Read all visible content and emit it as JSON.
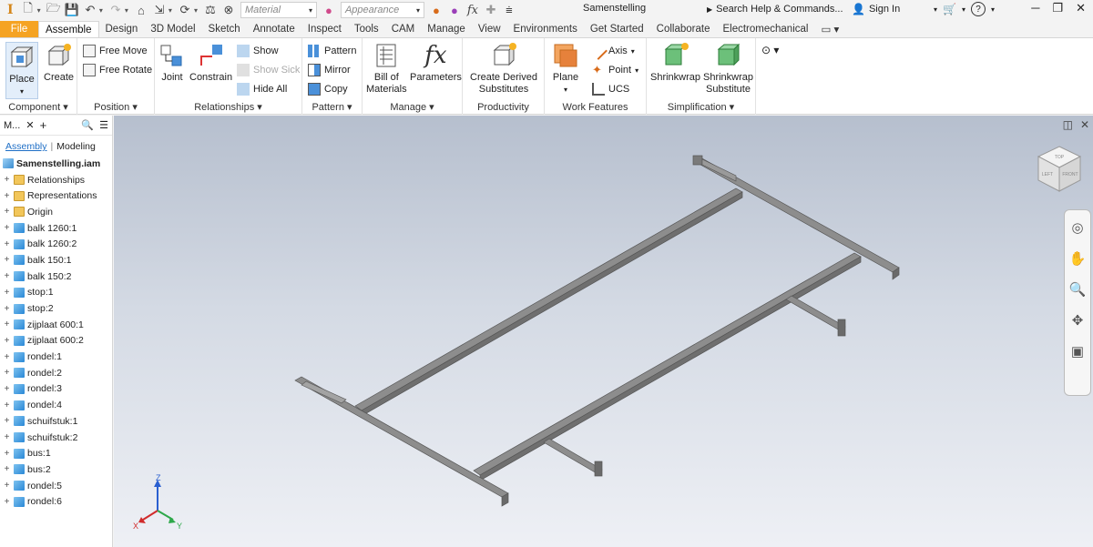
{
  "qat": {
    "app_logo": "I",
    "material_placeholder": "Material",
    "appearance_placeholder": "Appearance",
    "doc_title": "Samenstelling",
    "help_search": "Search Help & Commands...",
    "sign_in": "Sign In",
    "help_icon": "?"
  },
  "tabs": [
    "File",
    "Assemble",
    "Design",
    "3D Model",
    "Sketch",
    "Annotate",
    "Inspect",
    "Tools",
    "CAM",
    "Manage",
    "View",
    "Environments",
    "Get Started",
    "Collaborate",
    "Electromechanical"
  ],
  "active_tab": "Assemble",
  "ribbon": {
    "component": {
      "label": "Component ▾",
      "place": "Place",
      "create": "Create"
    },
    "position": {
      "label": "Position ▾",
      "free_move": "Free Move",
      "free_rotate": "Free Rotate"
    },
    "relationships": {
      "label": "Relationships ▾",
      "joint": "Joint",
      "constrain": "Constrain",
      "show": "Show",
      "show_sick": "Show Sick",
      "hide_all": "Hide All"
    },
    "pattern": {
      "label": "Pattern ▾",
      "pattern": "Pattern",
      "mirror": "Mirror",
      "copy": "Copy"
    },
    "manage": {
      "label": "Manage ▾",
      "bom_1": "Bill of",
      "bom_2": "Materials",
      "parameters": "Parameters"
    },
    "productivity": {
      "label": "Productivity",
      "derived_1": "Create Derived",
      "derived_2": "Substitutes"
    },
    "work_features": {
      "label": "Work Features",
      "plane": "Plane",
      "axis": "Axis",
      "point": "Point",
      "ucs": "UCS"
    },
    "simplification": {
      "label": "Simplification ▾",
      "shrinkwrap": "Shrinkwrap",
      "shrinkwrap_sub_1": "Shrinkwrap",
      "shrinkwrap_sub_2": "Substitute"
    }
  },
  "browser": {
    "title": "M...",
    "mode_assembly": "Assembly",
    "mode_modeling": "Modeling",
    "root": "Samenstelling.iam",
    "items": [
      {
        "label": "Relationships",
        "kind": "folder"
      },
      {
        "label": "Representations",
        "kind": "folder"
      },
      {
        "label": "Origin",
        "kind": "folder"
      },
      {
        "label": "balk 1260:1",
        "kind": "part"
      },
      {
        "label": "balk 1260:2",
        "kind": "part"
      },
      {
        "label": "balk 150:1",
        "kind": "part"
      },
      {
        "label": "balk 150:2",
        "kind": "part"
      },
      {
        "label": "stop:1",
        "kind": "part"
      },
      {
        "label": "stop:2",
        "kind": "part"
      },
      {
        "label": "zijplaat 600:1",
        "kind": "part"
      },
      {
        "label": "zijplaat 600:2",
        "kind": "part"
      },
      {
        "label": "rondel:1",
        "kind": "part"
      },
      {
        "label": "rondel:2",
        "kind": "part"
      },
      {
        "label": "rondel:3",
        "kind": "part"
      },
      {
        "label": "rondel:4",
        "kind": "part"
      },
      {
        "label": "schuifstuk:1",
        "kind": "part"
      },
      {
        "label": "schuifstuk:2",
        "kind": "part"
      },
      {
        "label": "bus:1",
        "kind": "part"
      },
      {
        "label": "bus:2",
        "kind": "part"
      },
      {
        "label": "rondel:5",
        "kind": "part"
      },
      {
        "label": "rondel:6",
        "kind": "part"
      }
    ]
  },
  "viewcube": {
    "top": "TOP",
    "front": "FRONT",
    "side": "LEFT"
  },
  "triad": {
    "x": "X",
    "y": "Y",
    "z": "Z"
  },
  "colors": {
    "file_tab": "#f5a323",
    "accent": "#1f6fc6",
    "part_blue": "#2a88d6"
  }
}
